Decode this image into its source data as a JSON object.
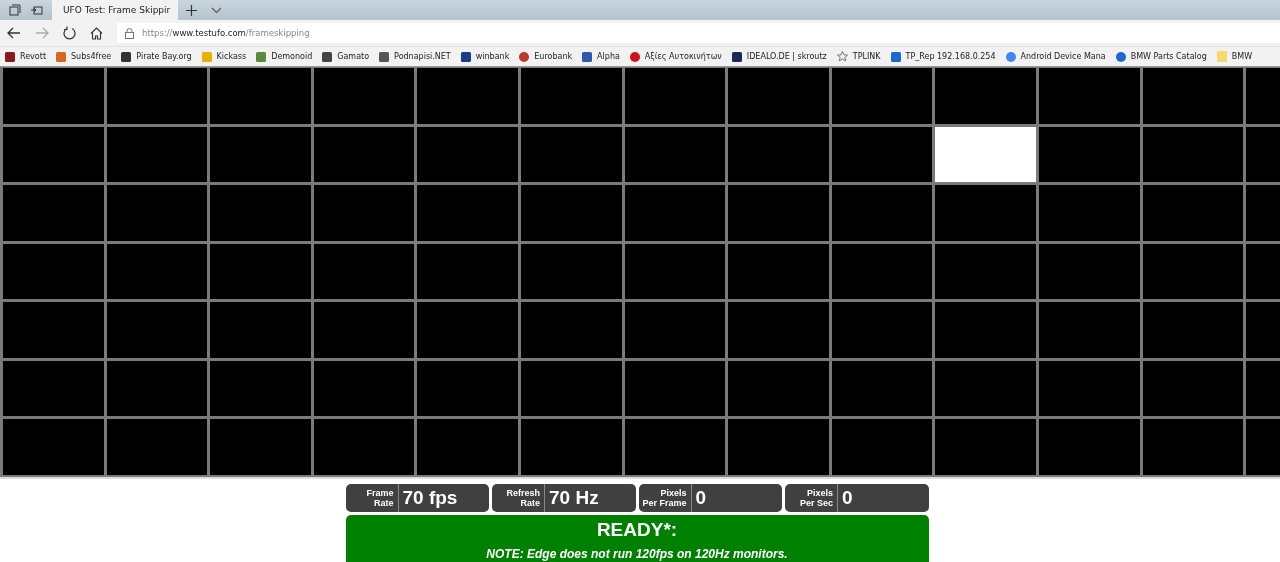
{
  "browser": {
    "tab": {
      "title": "UFO Test: Frame Skippir",
      "selected": true
    },
    "address": {
      "url_prefix": "https://",
      "url_host": "www.testufo.com",
      "url_path": "/frameskipping"
    },
    "bookmarks": [
      {
        "label": "Revott"
      },
      {
        "label": "Subs4free"
      },
      {
        "label": "Pirate Bay.org"
      },
      {
        "label": "Kickass"
      },
      {
        "label": "Demonoid"
      },
      {
        "label": "Gamato"
      },
      {
        "label": "Podnapisi.NET"
      },
      {
        "label": "winbank"
      },
      {
        "label": "Eurobank"
      },
      {
        "label": "Alpha"
      },
      {
        "label": "Αξίες Αυτοκινήτων"
      },
      {
        "label": "IDEALO.DE | skroutz"
      },
      {
        "label": "TPLINK"
      },
      {
        "label": "TP_Rep 192.168.0.254"
      },
      {
        "label": "Android Device Mana"
      },
      {
        "label": "BMW Parts Catalog"
      },
      {
        "label": "BMW"
      }
    ]
  },
  "grid": {
    "rows": [
      {
        "cells": [
          {
            "lit": false
          },
          {
            "lit": false
          },
          {
            "lit": false
          },
          {
            "lit": false
          },
          {
            "lit": false
          },
          {
            "lit": false
          },
          {
            "lit": false
          },
          {
            "lit": false
          },
          {
            "lit": false
          },
          {
            "lit": false
          },
          {
            "lit": false
          },
          {
            "lit": false
          },
          {
            "lit": false
          }
        ]
      },
      {
        "cells": [
          {
            "lit": false
          },
          {
            "lit": false
          },
          {
            "lit": false
          },
          {
            "lit": false
          },
          {
            "lit": false
          },
          {
            "lit": false
          },
          {
            "lit": false
          },
          {
            "lit": false
          },
          {
            "lit": false
          },
          {
            "lit": true
          },
          {
            "lit": false
          },
          {
            "lit": false
          },
          {
            "lit": false
          }
        ]
      },
      {
        "cells": [
          {
            "lit": false
          },
          {
            "lit": false
          },
          {
            "lit": false
          },
          {
            "lit": false
          },
          {
            "lit": false
          },
          {
            "lit": false
          },
          {
            "lit": false
          },
          {
            "lit": false
          },
          {
            "lit": false
          },
          {
            "lit": false
          },
          {
            "lit": false
          },
          {
            "lit": false
          },
          {
            "lit": false
          }
        ]
      },
      {
        "cells": [
          {
            "lit": false
          },
          {
            "lit": false
          },
          {
            "lit": false
          },
          {
            "lit": false
          },
          {
            "lit": false
          },
          {
            "lit": false
          },
          {
            "lit": false
          },
          {
            "lit": false
          },
          {
            "lit": false
          },
          {
            "lit": false
          },
          {
            "lit": false
          },
          {
            "lit": false
          },
          {
            "lit": false
          }
        ]
      },
      {
        "cells": [
          {
            "lit": false
          },
          {
            "lit": false
          },
          {
            "lit": false
          },
          {
            "lit": false
          },
          {
            "lit": false
          },
          {
            "lit": false
          },
          {
            "lit": false
          },
          {
            "lit": false
          },
          {
            "lit": false
          },
          {
            "lit": false
          },
          {
            "lit": false
          },
          {
            "lit": false
          },
          {
            "lit": false
          }
        ]
      },
      {
        "cells": [
          {
            "lit": false
          },
          {
            "lit": false
          },
          {
            "lit": false
          },
          {
            "lit": false
          },
          {
            "lit": false
          },
          {
            "lit": false
          },
          {
            "lit": false
          },
          {
            "lit": false
          },
          {
            "lit": false
          },
          {
            "lit": false
          },
          {
            "lit": false
          },
          {
            "lit": false
          },
          {
            "lit": false
          }
        ]
      },
      {
        "cells": [
          {
            "lit": false
          },
          {
            "lit": false
          },
          {
            "lit": false
          },
          {
            "lit": false
          },
          {
            "lit": false
          },
          {
            "lit": false
          },
          {
            "lit": false
          },
          {
            "lit": false
          },
          {
            "lit": false
          },
          {
            "lit": false
          },
          {
            "lit": false
          },
          {
            "lit": false
          },
          {
            "lit": false
          }
        ]
      }
    ]
  },
  "stats": [
    {
      "label": "Frame\nRate",
      "value": "70 fps"
    },
    {
      "label": "Refresh\nRate",
      "value": "70 Hz"
    },
    {
      "label": "Pixels\nPer Frame",
      "value": "0"
    },
    {
      "label": "Pixels\nPer Sec",
      "value": "0"
    }
  ],
  "status": {
    "title": "READY*:",
    "note": "NOTE: Edge does not run 120fps on 120Hz monitors."
  }
}
